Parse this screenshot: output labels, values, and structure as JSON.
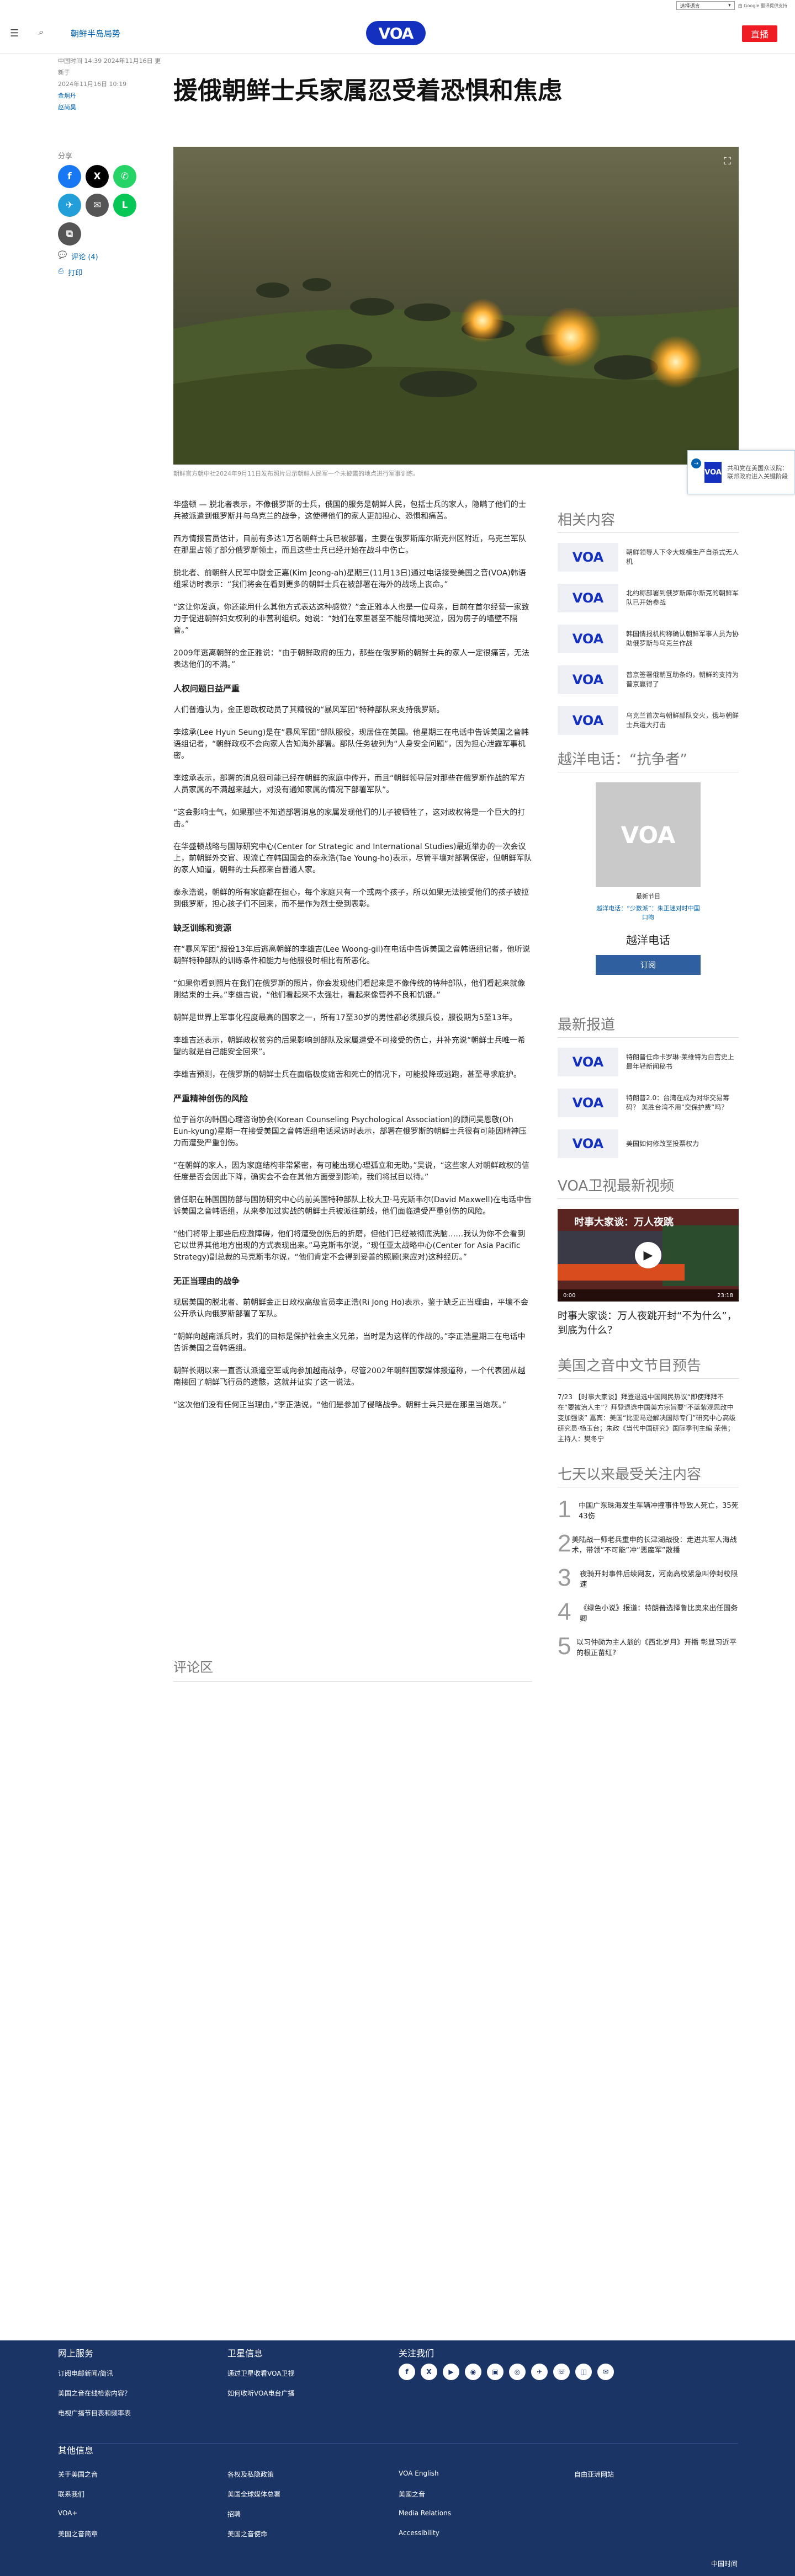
{
  "topbar": {
    "language": "选择语言",
    "powered_by": "由 Google 翻译提供支持",
    "translate_label": "翻译"
  },
  "header": {
    "section": "朝鲜半岛局势",
    "logo": "VOA",
    "live": "直播"
  },
  "meta": {
    "dates": "中国时间 14:39 2024年11月16日 更新于",
    "published": "2024年11月16日 10:19",
    "authors": [
      "金炯丹",
      "赵尚昊"
    ]
  },
  "article": {
    "title": "援俄朝鲜士兵家属忍受着恐惧和焦虑",
    "share_label": "分享",
    "comments_link": "评论 (4)",
    "print_link": "打印",
    "caption": "朝鲜官方朝中社2024年9月11日发布照片显示朝鲜人民军一个未披露的地点进行军事训练。",
    "paragraphs": [
      {
        "type": "p",
        "text": "华盛顿 — 脱北者表示，不像俄罗斯的士兵，俄国的服务是朝鲜人民，包括士兵的家人，隐瞒了他们的士兵被派遣到俄罗斯并与乌克兰的战争，这使得他们的家人更加担心、恐惧和痛苦。"
      },
      {
        "type": "p",
        "text": "西方情报官员估计，目前有多达1万名朝鲜士兵已被部署，主要在俄罗斯库尔斯克州区附近，乌克兰军队在那里占领了部分俄罗斯领土，而且这些士兵已经开始在战斗中伤亡。"
      },
      {
        "type": "p",
        "text": "脱北者、前朝鲜人民军中尉金正嘉(Kim Jeong-ah)星期三(11月13日)通过电话接受美国之音(VOA)韩语组采访时表示：“我们将会在看到更多的朝鲜士兵在被部署在海外的战场上丧命。”"
      },
      {
        "type": "p",
        "text": "“这让你发疯，你还能用什么其他方式表达这种感觉？”金正雅本人也是一位母亲，目前在首尔经营一家致力于促进朝鲜妇女权利的非营利组织。她说：“她们在家里甚至不能尽情地哭泣，因为房子的墙壁不隔音。”"
      },
      {
        "type": "p",
        "text": "2009年逃离朝鲜的金正雅说：“由于朝鲜政府的压力，那些在俄罗斯的朝鲜士兵的家人一定很痛苦，无法表达他们的不满。”"
      },
      {
        "type": "h",
        "text": "人权问题日益严重"
      },
      {
        "type": "p",
        "text": "人们普遍认为，金正恩政权动员了其精锐的“暴风军团”特种部队来支持俄罗斯。"
      },
      {
        "type": "p",
        "text": "李炫承(Lee Hyun Seung)是在“暴风军团”部队服役，现居住在美国。他星期三在电话中告诉美国之音韩语组记者，“朝鲜政权不会向家人告知海外部署。部队任务被列为“人身安全问题”，因为担心泄露军事机密。"
      },
      {
        "type": "p",
        "text": "李炫承表示，部署的消息很可能已经在朝鲜的家庭中传开，而且“朝鲜领导层对那些在俄罗斯作战的军方人员家属的不满越来越大，对没有通知家属的情况下部署军队”。"
      },
      {
        "type": "p",
        "text": "“这会影响士气，如果那些不知道部署消息的家属发现他们的儿子被牺牲了，这对政权将是一个巨大的打击。”"
      },
      {
        "type": "p",
        "text": "在华盛顿战略与国际研究中心(Center for Strategic and International Studies)最近举办的一次会议上，前朝鲜外交官、现流亡在韩国国会的泰永浩(Tae Young-ho)表示，尽管平壤对部署保密，但朝鲜军队的家人知道，朝鲜的士兵都来自普通人家。"
      },
      {
        "type": "p",
        "text": "泰永浩说，朝鲜的所有家庭都在担心，每个家庭只有一个或两个孩子，所以如果无法接受他们的孩子被拉到俄罗斯，担心孩子们不回来，而不是作为烈士受到表彰。"
      },
      {
        "type": "h",
        "text": "缺乏训练和资源"
      },
      {
        "type": "p",
        "text": "在“暴风军团”服役13年后逃离朝鲜的李雄吉(Lee Woong-gil)在电话中告诉美国之音韩语组记者，他听说朝鲜特种部队的训练条件和能力与他服役时相比有所恶化。"
      },
      {
        "type": "p",
        "text": "“如果你看到照片在我们在俄罗斯的照片，你会发现他们看起来是不像传统的特种部队，他们看起来就像刚结束的士兵。”李雄吉说，“他们看起来不太强壮，看起来像营养不良和饥饿。”"
      },
      {
        "type": "p",
        "text": "朝鲜是世界上军事化程度最高的国家之一，所有17至30岁的男性都必须服兵役，服役期为5至13年。"
      },
      {
        "type": "p",
        "text": "李雄吉还表示，朝鲜政权贫穷的后果影响到部队及家属遭受不可接受的伤亡，并补充说“朝鲜士兵唯一希望的就是自己能安全回来”。"
      },
      {
        "type": "p",
        "text": "李雄吉预测，在俄罗斯的朝鲜士兵在面临极度痛苦和死亡的情况下，可能投降或逃跑，甚至寻求庇护。"
      },
      {
        "type": "h",
        "text": "严重精神创伤的风险"
      },
      {
        "type": "p",
        "text": "位于首尔的韩国心理咨询协会(Korean Counseling Psychological Association)的顾问吴恩敬(Oh Eun-kyung)星期一在接受美国之音韩语组电话采访时表示，部署在俄罗斯的朝鲜士兵很有可能因精神压力而遭受严重创伤。"
      },
      {
        "type": "p",
        "text": "“在朝鲜的家人，因为家庭结构非常紧密，有可能出现心理孤立和无助。”吴说，“这些家人对朝鲜政权的信任度是否会因此下降，确实会不会在其他方面受到影响，我们将拭目以待。”"
      },
      {
        "type": "p",
        "text": "曾任职在韩国国防部与国防研究中心的前美国特种部队上校大卫·马克斯韦尔(David Maxwell)在电话中告诉美国之音韩语组，从来参加过实战的朝鲜士兵被派往前线，他们面临遭受严重创伤的风险。"
      },
      {
        "type": "p",
        "text": "“他们将带上那些后应激障碍，他们将遭受创伤后的折磨，但他们已经被彻底洗脑……我认为你不会看到它以世界其他地方出现的方式表现出来。”马克斯韦尔说，“现任亚太战略中心(Center for Asia Pacific Strategy)副总裁的马克斯韦尔说，“他们肯定不会得到妥善的照顾(来应对)这种经历。”"
      },
      {
        "type": "h",
        "text": "无正当理由的战争"
      },
      {
        "type": "p",
        "text": "现居美国的脱北者、前朝鲜金正日政权高级官员李正浩(Ri Jong Ho)表示，鉴于缺乏正当理由，平壤不会公开承认向俄罗斯部署了军队。"
      },
      {
        "type": "p",
        "text": "“朝鲜向越南派兵时，我们的目标是保护社会主义兄弟，当时是为这样的作战的。”李正浩星期三在电话中告诉美国之音韩语组。"
      },
      {
        "type": "p",
        "text": "朝鲜长期以来一直否认派遣空军或向参加越南战争，尽管2002年朝鲜国家媒体报道称，一个代表团从越南接回了朝鲜飞行员的遗骸，这就并证实了这一说法。"
      },
      {
        "type": "p",
        "text": "“这次他们没有任何正当理由，”李正浩说，“他们是参加了侵略战争。朝鲜士兵只是在那里当炮灰。”"
      }
    ],
    "comments_heading": "评论区"
  },
  "mini_player": {
    "logo": "VOA",
    "text": "共和党在美国众议院：联邦政府进入关键阶段"
  },
  "sidebar": {
    "related_heading": "相关内容",
    "related": [
      "朝鲜领导人下令大规模生产自杀式无人机",
      "北约称部署到俄罗斯库尔斯克的朝鲜军队已开始参战",
      "韩国情报机构称确认朝鲜军事人员为协助俄罗斯与乌克兰作战",
      "普京签署俄朝互助条约，朝鲜的支持为普京赢得了",
      "乌克兰首次与朝鲜部队交火，俄与朝鲜士兵遭大打击"
    ],
    "radio_heading": "越洋电话：“抗争者”",
    "radio": {
      "logo": "VOA",
      "status": "最新节目",
      "latest": "越洋电话：“少数派”：朱正迷对时中国口吻",
      "name": "越洋电话",
      "subscribe": "订阅"
    },
    "latest_heading": "最新报道",
    "latest": [
      "特朗普任命卡罗琳·莱维特为白宫史上最年轻新闻秘书",
      "特朗普2.0：台湾在成为对华交易筹码？ 美胜台湾不用“交保护费”吗？",
      "美国如何修改至投票权力"
    ],
    "video_heading": "VOA卫视最新视频",
    "video": {
      "overlay": "时事大家谈：万人夜跳",
      "time": "0:00",
      "duration": "23:18",
      "title": "时事大家谈：万人夜跳开封“不为什么”，到底为什么？"
    },
    "program_heading": "美国之音中文节目预告",
    "program_text": "7/23 【时事大家谈】拜登退选中国网民热议“即使拜拜不在”要被治人主”？拜登退选中国美方宗旨要“不蓝紫观思改中变加强谈”  嘉宾：美国“比亚马逊解决国际专门”研究中心高级研究员·杨玉台；朱政《当代中国研究》国际季刊主编 荣伟；主持人：樊冬宁",
    "popular_heading": "七天以来最受关注内容",
    "popular": [
      {
        "rank": "1",
        "text": "中国广东珠海发生车辆冲撞事件导致人死亡，35死43伤"
      },
      {
        "rank": "2",
        "text": "美陆战一师老兵重申的长津湖战役：走进共军人海战术，带领“不可能”冲“恶魔军”散播"
      },
      {
        "rank": "3",
        "text": "夜骑开封事件后续网友，河南高校紧急叫停封校限速"
      },
      {
        "rank": "4",
        "text": "《绿色小说》报道：特朗普选择鲁比奥来出任国务卿"
      },
      {
        "rank": "5",
        "text": "以习仲勋为主人翁的《西北岁月》开播 彰显习近平的根正苗红?"
      }
    ]
  },
  "footer": {
    "col1_heading": "网上服务",
    "col1": [
      "订阅电邮新闻/简讯",
      "美国之音在线检索内容？",
      "电视广播节目表和频率表"
    ],
    "col2_heading": "卫星信息",
    "col2": [
      "通过卫星收看VOA卫视",
      "如何收听VOA电台广播"
    ],
    "col3_heading": "关注我们",
    "social": [
      "f",
      "X",
      "▶",
      "◉",
      "▣",
      "◎",
      "✈",
      "☏",
      "◫",
      "✉"
    ],
    "other_heading": "其他信息",
    "links": [
      [
        "关于美国之音",
        "各权及私隐政策",
        "VOA English",
        "自由亚洲网站"
      ],
      [
        "联系我们",
        "美国全球媒体总署",
        "美國之音",
        ""
      ],
      [
        "VOA+",
        "招聘",
        "Media Relations",
        ""
      ],
      [
        "美国之音简章",
        "美国之音使命",
        "Accessibility",
        ""
      ]
    ],
    "copyright": "中国时间"
  }
}
